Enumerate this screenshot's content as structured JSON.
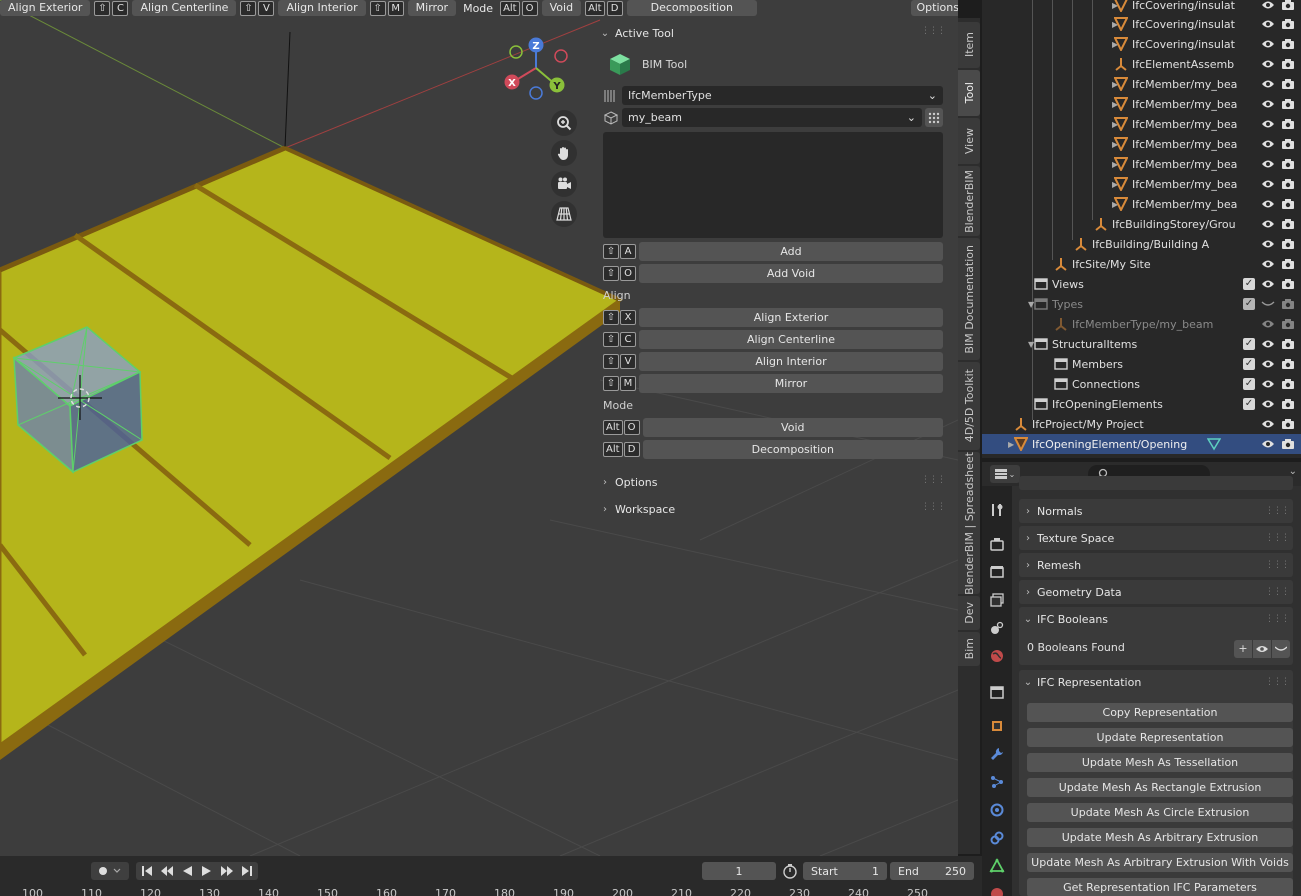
{
  "header": {
    "align_exterior": "Align Exterior",
    "align_centerline": "Align Centerline",
    "align_interior": "Align Interior",
    "mirror": "Mirror",
    "mode": "Mode",
    "void": "Void",
    "decomposition": "Decomposition",
    "options": "Options",
    "keys": {
      "shift": "⇧",
      "c": "C",
      "v": "V",
      "m": "M",
      "alt": "Alt",
      "o": "O",
      "d": "D"
    }
  },
  "gizmo": {
    "z": "Z",
    "x": "X",
    "y": "Y"
  },
  "tool_panel": {
    "active_tool_title": "Active Tool",
    "tool_name": "BIM Tool",
    "ifc_class": "IfcMemberType",
    "relating_type": "my_beam",
    "buttons": [
      {
        "key": "A",
        "label": "Add"
      },
      {
        "key": "O",
        "label": "Add Void"
      }
    ],
    "align_label": "Align",
    "align_buttons": [
      {
        "key": "X",
        "label": "Align Exterior"
      },
      {
        "key": "C",
        "label": "Align Centerline"
      },
      {
        "key": "V",
        "label": "Align Interior"
      },
      {
        "key": "M",
        "label": "Mirror"
      }
    ],
    "mode_label": "Mode",
    "mode_buttons": [
      {
        "key": "O",
        "label": "Void"
      },
      {
        "key": "D",
        "label": "Decomposition"
      }
    ],
    "options_title": "Options",
    "workspace_title": "Workspace",
    "shift_key": "⇧",
    "alt_key": "Alt"
  },
  "side_tabs": [
    "Item",
    "Tool",
    "View",
    "BlenderBIM",
    "BIM Documentation",
    "4D/5D Toolkit",
    "BlenderBIM | Spreadsheet",
    "Dev",
    "Bim"
  ],
  "outliner": {
    "rows": [
      {
        "name": "IfcCovering/insulat"
      },
      {
        "name": "IfcCovering/insulat"
      },
      {
        "name": "IfcCovering/insulat"
      },
      {
        "name": "IfcElementAssemb"
      },
      {
        "name": "IfcMember/my_bea"
      },
      {
        "name": "IfcMember/my_bea"
      },
      {
        "name": "IfcMember/my_bea"
      },
      {
        "name": "IfcMember/my_bea"
      },
      {
        "name": "IfcMember/my_bea"
      },
      {
        "name": "IfcMember/my_bea"
      },
      {
        "name": "IfcMember/my_bea"
      },
      {
        "name": "IfcBuildingStorey/Grou"
      },
      {
        "name": "IfcBuilding/Building A"
      },
      {
        "name": "IfcSite/My Site"
      },
      {
        "name": "Views"
      },
      {
        "name": "Types"
      },
      {
        "name": "IfcMemberType/my_beam"
      },
      {
        "name": "StructuralItems"
      },
      {
        "name": "Members"
      },
      {
        "name": "Connections"
      },
      {
        "name": "IfcOpeningElements"
      },
      {
        "name": "IfcProject/My Project"
      },
      {
        "name": "IfcOpeningElement/Opening"
      }
    ]
  },
  "properties": {
    "sections": [
      "Normals",
      "Texture Space",
      "Remesh",
      "Geometry Data",
      "IFC Booleans",
      "IFC Representation"
    ],
    "booleans_found": "0 Booleans Found",
    "booleans_add": "+",
    "representation_buttons": [
      "Copy Representation",
      "Update Representation",
      "Update Mesh As Tessellation",
      "Update Mesh As Rectangle Extrusion",
      "Update Mesh As Circle Extrusion",
      "Update Mesh As Arbitrary Extrusion",
      "Update Mesh As Arbitrary Extrusion With Voids",
      "Get Representation IFC Parameters"
    ]
  },
  "timeline": {
    "current_frame": "1",
    "start_label": "Start",
    "start_value": "1",
    "end_label": "End",
    "end_value": "250",
    "ruler": [
      "100",
      "110",
      "120",
      "130",
      "140",
      "150",
      "160",
      "170",
      "180",
      "190",
      "200",
      "210",
      "220",
      "230",
      "240",
      "250"
    ]
  },
  "colors": {
    "slab_yellow": "#b5b51b",
    "slab_edge": "#8a6a10",
    "selection_blue": "#334d80",
    "accent_orange": "#d88a3a"
  }
}
